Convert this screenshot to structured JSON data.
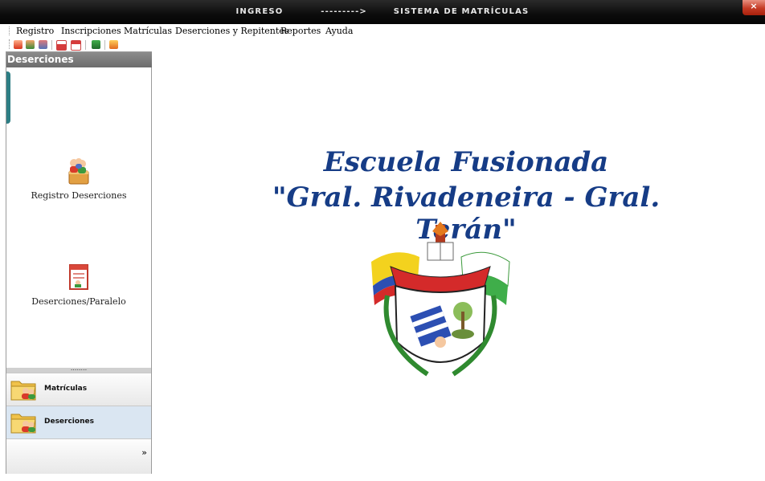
{
  "window": {
    "title": "INGRESO          --------->       SISTEMA DE MATRÍCULAS",
    "close_glyph": "×"
  },
  "menu": [
    "Registro",
    "Inscripciones",
    "Matrículas",
    "Deserciones y Repitentes",
    "Reportes",
    "Ayuda"
  ],
  "toolbar": [
    "home-icon",
    "users-icon",
    "people-icon",
    "calendar-icon",
    "calendar-alt-icon",
    "book-icon",
    "basket-icon"
  ],
  "sidebar": {
    "header": "Deserciones",
    "items": [
      {
        "label": "Registro Deserciones",
        "icon": "user-box-icon"
      },
      {
        "label": "Deserciones/Paralelo",
        "icon": "report-icon"
      }
    ],
    "groups": [
      {
        "label": "Matrículas",
        "icon": "folder-users-icon"
      },
      {
        "label": "Deserciones",
        "icon": "folder-users-icon"
      }
    ],
    "overflow_glyph": "»"
  },
  "main": {
    "school_line1": "Escuela Fusionada",
    "school_line2": "\"Gral. Rivadeneira - Gral. Terán\"",
    "crest": "school-crest-image"
  }
}
